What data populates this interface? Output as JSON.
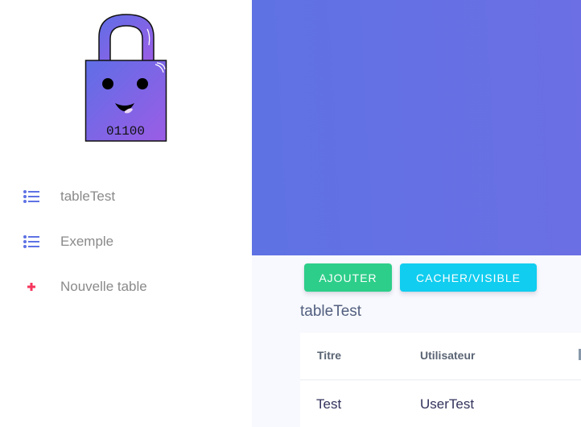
{
  "logo": {
    "code_text": "01100"
  },
  "sidebar": {
    "items": [
      {
        "label": "tableTest",
        "icon": "list-icon",
        "color": "#5e72e4"
      },
      {
        "label": "Exemple",
        "icon": "list-icon",
        "color": "#5e72e4"
      },
      {
        "label": "Nouvelle table",
        "icon": "plus-icon",
        "color": "#f5365c"
      }
    ]
  },
  "toolbar": {
    "add_label": "AJOUTER",
    "toggle_label": "CACHER/VISIBLE"
  },
  "table": {
    "title": "tableTest",
    "headers": [
      "Titre",
      "Utilisateur"
    ],
    "rows": [
      [
        "Test",
        "UserTest"
      ]
    ]
  },
  "colors": {
    "primary": "#5e72e4",
    "success": "#2dce89",
    "info": "#11cdef",
    "danger": "#f5365c"
  }
}
